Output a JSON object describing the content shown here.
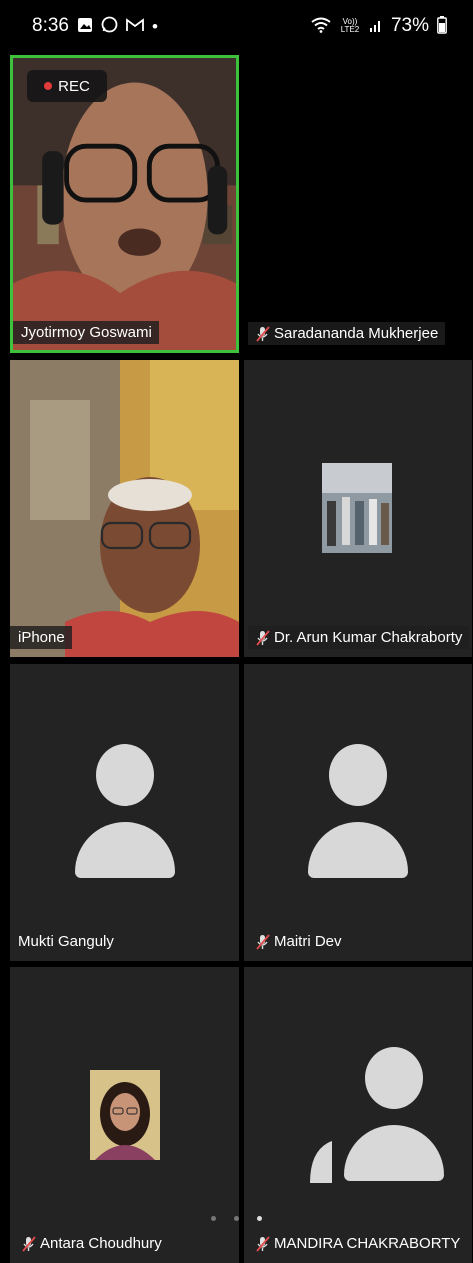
{
  "status_bar": {
    "time": "8:36",
    "network_label": "Vo)) LTE2",
    "battery": "73%",
    "notification_icons": [
      "gallery-icon",
      "whatsapp-icon",
      "gmail-icon",
      "dot-icon"
    ],
    "system_icons": [
      "wifi-icon",
      "volte-icon",
      "signal-icon",
      "battery-icon"
    ]
  },
  "recording": {
    "label": "REC"
  },
  "participants": [
    {
      "name": "Jyotirmoy Goswami",
      "muted": false,
      "video": true,
      "active_speaker": true
    },
    {
      "name": "Saradananda Mukherjee",
      "muted": true,
      "video": false
    },
    {
      "name": "iPhone",
      "muted": false,
      "video": true
    },
    {
      "name": "Dr. Arun Kumar Chakraborty",
      "muted": true,
      "video": false,
      "thumbnail": true
    },
    {
      "name": "Mukti Ganguly",
      "muted": false,
      "video": false
    },
    {
      "name": "Maitri Dev",
      "muted": true,
      "video": false
    },
    {
      "name": "Antara Choudhury",
      "muted": true,
      "video": false,
      "thumbnail": true
    },
    {
      "name": "MANDIRA CHAKRABORTY",
      "muted": true,
      "video": false
    }
  ],
  "pagination": {
    "pages": 3,
    "current": 3
  },
  "colors": {
    "active_speaker_border": "#3ec23e",
    "tile_background": "#232323",
    "avatar": "#d8d8d8"
  }
}
